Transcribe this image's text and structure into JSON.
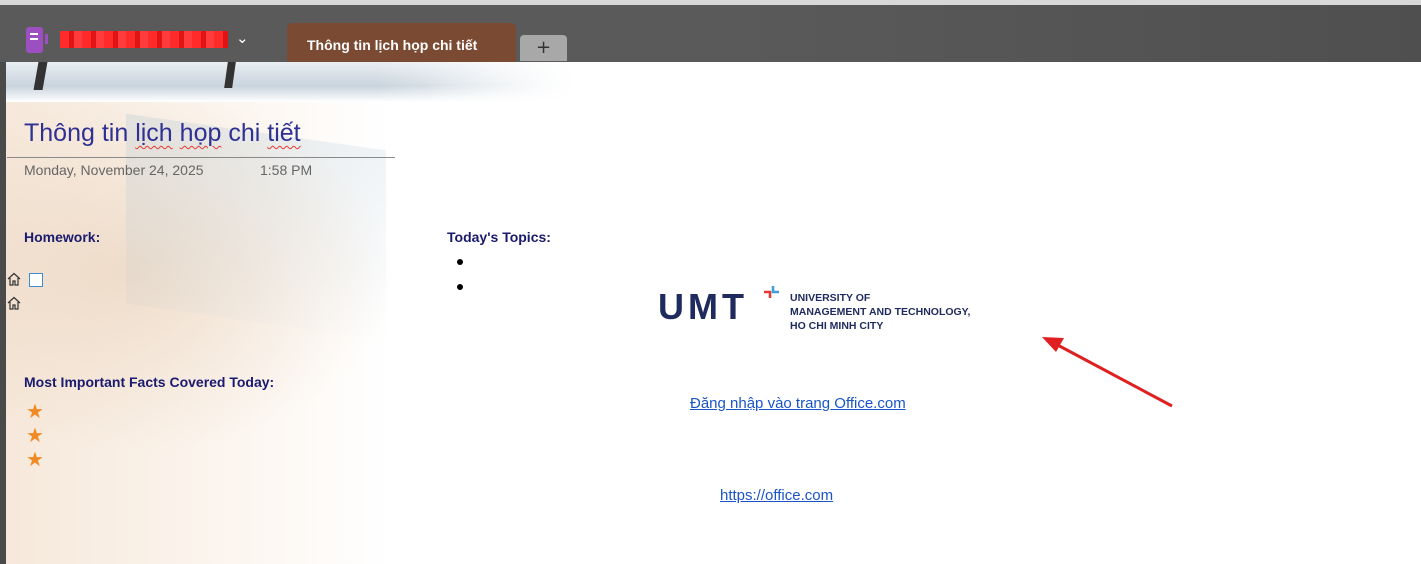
{
  "tabbar": {
    "notebook_icon": "onenote-notebook-icon",
    "notebook_name_redacted": true,
    "dropdown_icon": "chevron-down-icon",
    "active_tab": "Thông tin lịch họp chi tiết",
    "add_tab": "+"
  },
  "page": {
    "title_words": [
      "Thông tin",
      "lịch",
      "họp",
      "chi",
      "tiết"
    ],
    "date": "Monday, November 24, 2025",
    "time": "1:58 PM"
  },
  "sections": {
    "homework": "Homework:",
    "topics": "Today's Topics:",
    "facts": "Most Important Facts Covered Today:",
    "homework_icons": [
      "home-icon",
      "home-icon"
    ],
    "topics_bullets": 2,
    "facts_stars": 3
  },
  "logo": {
    "mark": "UMT",
    "line1": "UNIVERSITY OF",
    "line2": "MANAGEMENT AND TECHNOLOGY,",
    "line3": "HO CHI MINH CITY"
  },
  "links": {
    "signin": "Đăng nhập vào trang Office.com",
    "url": "https://office.com"
  },
  "colors": {
    "title": "#2e3192",
    "heading": "#1a1a6e",
    "active_tab": "#7b4a32",
    "star": "#f08a24",
    "link": "#1a55c8",
    "arrow": "#e02020",
    "logo": "#1f2a5e"
  }
}
